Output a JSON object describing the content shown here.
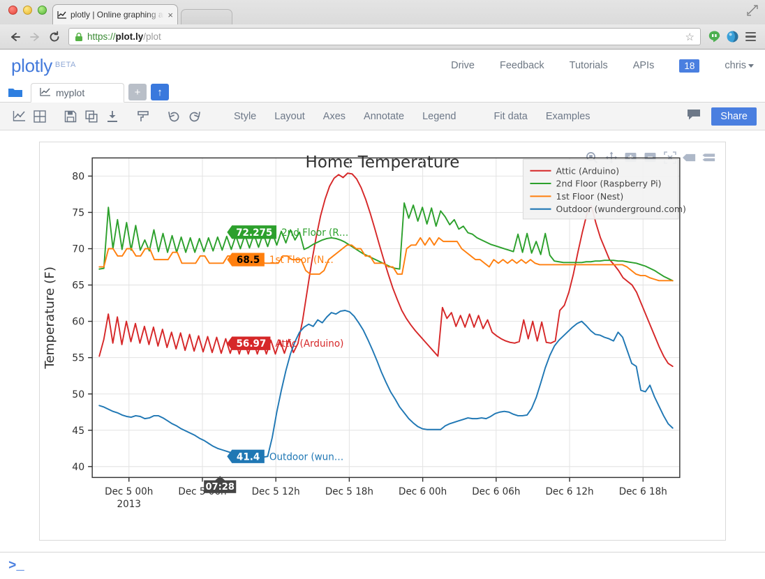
{
  "browser": {
    "tab_title": "plotly | Online graphing an",
    "tab_close": "×",
    "url_scheme": "https://",
    "url_host": "plot.ly",
    "url_path": "/plot",
    "back_icon": "back-arrow-icon",
    "forward_icon": "forward-arrow-icon",
    "reload_icon": "reload-icon",
    "star_icon": "☆",
    "hangouts_icon": "hangouts-icon",
    "pocket_icon": "pocket-icon",
    "menu_icon": "hamburger-menu-icon"
  },
  "header": {
    "brand": "plotly",
    "beta": "BETA",
    "nav": [
      {
        "label": "Drive"
      },
      {
        "label": "Feedback"
      },
      {
        "label": "Tutorials"
      },
      {
        "label": "APIs"
      }
    ],
    "badge_count": "18",
    "user": "chris",
    "badge_color": "#4a7fe0"
  },
  "filebar": {
    "folder_icon": "folder-icon",
    "tab_name": "myplot",
    "tab_icon": "line-chart-icon",
    "add_label": "+",
    "upload_label": "↑"
  },
  "toolbar": {
    "icons": [
      {
        "name": "line-chart-icon"
      },
      {
        "name": "grid-table-icon"
      },
      {
        "name": "save-icon"
      },
      {
        "name": "copy-icon"
      },
      {
        "name": "download-icon"
      },
      {
        "name": "paint-roller-icon"
      },
      {
        "name": "undo-icon"
      },
      {
        "name": "redo-icon"
      }
    ],
    "menus": [
      "Style",
      "Layout",
      "Axes",
      "Annotate",
      "Legend"
    ],
    "actions": [
      "Fit data",
      "Examples"
    ],
    "comment_icon": "comment-bubble-icon",
    "share_label": "Share",
    "share_color": "#4a7fe0"
  },
  "modebar": {
    "items": [
      {
        "name": "zoom-magnifier-icon"
      },
      {
        "name": "pan-move-icon"
      },
      {
        "name": "zoom-in-icon"
      },
      {
        "name": "zoom-out-icon"
      },
      {
        "name": "autoscale-icon"
      },
      {
        "name": "hover-compare-icon"
      },
      {
        "name": "hover-closest-icon"
      }
    ]
  },
  "console": {
    "prompt": ">_"
  },
  "chart_data": {
    "type": "line",
    "title": "Home Temperature",
    "xlabel": "",
    "ylabel": "Temperature (F)",
    "ylim": [
      38.5,
      82.5
    ],
    "yticks": [
      40,
      45,
      50,
      55,
      60,
      65,
      70,
      75,
      80
    ],
    "xticks": [
      {
        "label": "Dec 5 00h",
        "sublabel": "2013",
        "pos": 0.0625
      },
      {
        "label": "Dec 5 06h",
        "sublabel": "",
        "pos": 0.1875
      },
      {
        "label": "Dec 5 12h",
        "sublabel": "",
        "pos": 0.3125
      },
      {
        "label": "Dec 5 18h",
        "sublabel": "",
        "pos": 0.4375
      },
      {
        "label": "Dec 6 00h",
        "sublabel": "",
        "pos": 0.5625
      },
      {
        "label": "Dec 6 06h",
        "sublabel": "",
        "pos": 0.6875
      },
      {
        "label": "Dec 6 12h",
        "sublabel": "",
        "pos": 0.8125
      },
      {
        "label": "Dec 6 18h",
        "sublabel": "",
        "pos": 0.9375
      }
    ],
    "grid": true,
    "legend_position": "top-right",
    "cursor": {
      "x_label": "07:28",
      "pos": 0.2175
    },
    "hover_labels": [
      {
        "value": "72.275",
        "series": "2nd Floor (R…",
        "color": "#2ca02c",
        "text_color": "#ffffff"
      },
      {
        "value": "68.5",
        "series": "1st Floor (N…",
        "color": "#ff7f0e",
        "text_color": "#000000"
      },
      {
        "value": "56.97",
        "series": "Attic (Arduino)",
        "color": "#d62728",
        "text_color": "#ffffff"
      },
      {
        "value": "41.4",
        "series": "Outdoor (wun…",
        "color": "#1f77b4",
        "text_color": "#ffffff"
      }
    ],
    "series": [
      {
        "name": "Attic (Arduino)",
        "color": "#d62728",
        "values": [
          55.2,
          57.5,
          61.0,
          57.0,
          60.6,
          56.8,
          60.0,
          57.2,
          59.7,
          57.0,
          59.3,
          56.8,
          59.2,
          56.6,
          58.9,
          56.4,
          58.5,
          56.2,
          58.4,
          56.0,
          58.2,
          55.9,
          58.0,
          55.8,
          57.9,
          55.7,
          57.8,
          55.6,
          57.6,
          55.6,
          57.6,
          55.5,
          57.5,
          55.5,
          57.5,
          55.5,
          57.4,
          55.5,
          57.4,
          55.5,
          57.4,
          55.6,
          57.5,
          55.7,
          56.97,
          60.0,
          64.0,
          68.0,
          71.5,
          74.5,
          76.8,
          78.6,
          79.7,
          80.2,
          79.8,
          80.4,
          80.3,
          79.6,
          78.4,
          76.8,
          74.9,
          72.8,
          70.6,
          68.5,
          66.5,
          64.6,
          63.0,
          61.5,
          60.4,
          59.5,
          58.7,
          58.0,
          57.3,
          56.6,
          55.9,
          55.2,
          61.9,
          60.4,
          61.2,
          59.3,
          60.8,
          59.2,
          61.0,
          59.2,
          60.8,
          59.0,
          60.2,
          58.5,
          58.0,
          57.6,
          57.3,
          57.1,
          57.0,
          57.2,
          60.2,
          57.6,
          60.0,
          57.3,
          59.9,
          57.1,
          57.0,
          57.3,
          61.5,
          62.2,
          64.0,
          66.5,
          69.5,
          72.3,
          74.8,
          75.9,
          73.5,
          71.5,
          70.0,
          68.5,
          67.8,
          67.0,
          66.0,
          65.5,
          65.0,
          64.0,
          62.5,
          61.0,
          59.5,
          58.0,
          56.5,
          55.2,
          54.2,
          53.8
        ]
      },
      {
        "name": "2nd Floor (Raspberry Pi)",
        "color": "#2ca02c",
        "values": [
          67.2,
          67.3,
          75.7,
          70.0,
          74.0,
          69.9,
          73.6,
          69.8,
          73.2,
          69.8,
          71.2,
          69.7,
          72.6,
          69.6,
          72.1,
          69.5,
          71.8,
          69.5,
          71.6,
          69.5,
          71.5,
          69.5,
          71.4,
          69.6,
          71.5,
          69.7,
          71.6,
          69.8,
          71.7,
          69.9,
          71.8,
          70.0,
          71.9,
          70.1,
          72.0,
          70.2,
          72.1,
          70.3,
          72.2,
          70.5,
          72.4,
          70.8,
          72.6,
          71.2,
          72.275,
          69.9,
          70.2,
          70.6,
          70.9,
          71.2,
          71.4,
          71.5,
          71.4,
          71.2,
          70.9,
          70.5,
          70.1,
          69.7,
          69.3,
          69.0,
          68.7,
          68.4,
          68.1,
          67.8,
          67.5,
          67.3,
          67.2,
          76.3,
          74.2,
          76.0,
          73.8,
          75.7,
          73.4,
          75.6,
          73.1,
          75.2,
          74.4,
          73.3,
          74.0,
          72.7,
          73.1,
          72.2,
          72.0,
          71.5,
          71.2,
          70.9,
          70.6,
          70.4,
          70.2,
          70.0,
          69.8,
          69.6,
          72.0,
          69.5,
          72.1,
          69.4,
          71.0,
          69.2,
          72.1,
          69.1,
          68.3,
          68.2,
          68.1,
          68.1,
          68.1,
          68.1,
          68.1,
          68.2,
          68.2,
          68.3,
          68.3,
          68.4,
          68.4,
          68.4,
          68.3,
          68.3,
          68.2,
          68.1,
          68.0,
          67.8,
          67.6,
          67.3,
          67.0,
          66.6,
          66.2,
          65.9,
          65.6
        ]
      },
      {
        "name": "1st Floor (Nest)",
        "color": "#ff7f0e",
        "values": [
          67.5,
          67.5,
          70.0,
          70.0,
          69.0,
          69.0,
          70.0,
          70.0,
          69.0,
          69.0,
          70.0,
          70.0,
          68.5,
          68.5,
          68.5,
          68.5,
          69.5,
          69.5,
          68.0,
          68.0,
          68.0,
          68.0,
          69.0,
          69.0,
          68.0,
          68.0,
          68.0,
          68.0,
          69.0,
          69.0,
          68.0,
          68.0,
          68.0,
          68.0,
          69.0,
          69.0,
          68.0,
          68.0,
          68.0,
          68.0,
          69.0,
          69.0,
          68.5,
          68.5,
          68.5,
          67.0,
          66.5,
          66.5,
          66.5,
          67.0,
          68.5,
          69.0,
          69.5,
          70.0,
          70.5,
          70.5,
          70.0,
          70.0,
          69.0,
          69.0,
          68.0,
          68.0,
          68.0,
          67.5,
          67.5,
          66.5,
          66.5,
          70.0,
          70.5,
          70.5,
          71.5,
          70.5,
          71.5,
          70.5,
          71.5,
          71.0,
          71.0,
          71.0,
          71.0,
          70.0,
          69.5,
          69.0,
          68.5,
          68.5,
          68.0,
          67.5,
          68.5,
          68.0,
          68.5,
          68.0,
          68.5,
          68.0,
          68.5,
          68.0,
          68.5,
          68.0,
          67.8,
          67.8,
          67.8,
          67.8,
          67.8,
          67.8,
          67.8,
          67.8,
          67.8,
          67.8,
          67.8,
          67.8,
          67.8,
          67.8,
          67.8,
          67.8,
          67.8,
          67.8,
          67.8,
          67.5,
          67.0,
          66.5,
          66.3,
          66.3,
          66.0,
          65.8,
          65.6,
          65.6,
          65.6,
          65.6
        ]
      },
      {
        "name": "Outdoor (wunderground.com)",
        "color": "#1f77b4",
        "values": [
          48.4,
          48.2,
          47.9,
          47.6,
          47.4,
          47.1,
          46.9,
          46.8,
          47.0,
          46.9,
          46.6,
          46.7,
          47.0,
          47.0,
          46.7,
          46.3,
          45.9,
          45.6,
          45.2,
          44.9,
          44.6,
          44.3,
          43.9,
          43.6,
          43.2,
          42.8,
          42.5,
          42.3,
          42.1,
          41.9,
          41.7,
          41.5,
          41.3,
          41.2,
          41.0,
          41.0,
          41.3,
          41.4,
          44.0,
          47.5,
          50.5,
          53.2,
          55.5,
          57.2,
          58.5,
          59.2,
          59.6,
          59.3,
          60.2,
          59.8,
          60.6,
          61.2,
          61.0,
          61.4,
          61.5,
          61.3,
          60.7,
          59.8,
          58.8,
          57.5,
          56.1,
          54.6,
          53.0,
          51.6,
          50.3,
          49.3,
          48.2,
          47.4,
          46.6,
          46.0,
          45.5,
          45.2,
          45.1,
          45.1,
          45.1,
          45.1,
          45.6,
          45.9,
          46.1,
          46.3,
          46.5,
          46.7,
          46.6,
          46.6,
          46.7,
          46.6,
          46.9,
          47.3,
          47.5,
          47.6,
          47.5,
          47.2,
          47.0,
          47.0,
          47.1,
          48.0,
          49.5,
          51.5,
          53.6,
          55.3,
          56.6,
          57.4,
          58.0,
          58.6,
          59.2,
          59.7,
          60.0,
          59.4,
          58.7,
          58.2,
          58.1,
          57.8,
          57.6,
          57.3,
          58.5,
          57.8,
          56.0,
          54.2,
          53.8,
          50.5,
          50.3,
          51.2,
          49.6,
          48.3,
          47.0,
          45.9,
          45.3
        ]
      }
    ]
  }
}
